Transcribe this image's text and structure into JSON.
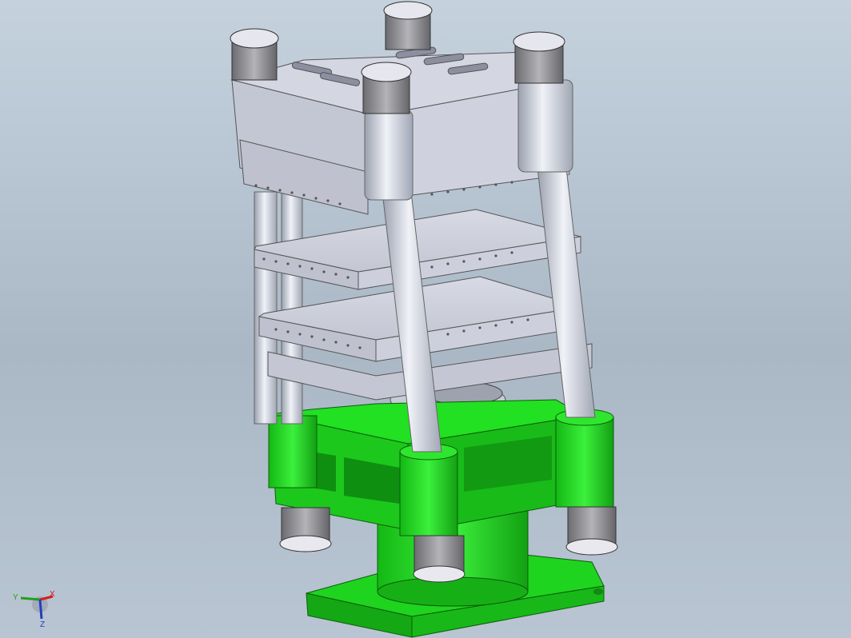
{
  "viewport": {
    "background_top": "#c5d2de",
    "background_bottom": "#b9c5d2"
  },
  "model": {
    "parts": {
      "frame_color": "#c9cbd8",
      "base_color": "#1ee01e",
      "base_dark": "#14a814",
      "column_color": "#b8bcc8",
      "nut_color": "#8a8a8a"
    }
  },
  "triad": {
    "x_label": "X",
    "y_label": "Y",
    "z_label": "Z",
    "x_color": "#d02020",
    "y_color": "#20a020",
    "z_color": "#2040c0",
    "icon": "coordinate-triad-icon"
  }
}
